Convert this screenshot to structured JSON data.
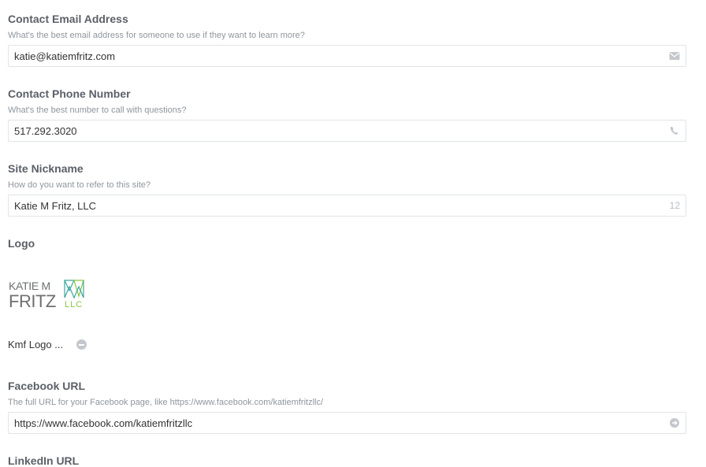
{
  "contact_email": {
    "label": "Contact Email Address",
    "help": "What's the best email address for someone to use if they want to learn more?",
    "value": "katie@katiemfritz.com",
    "icon": "envelope-icon"
  },
  "contact_phone": {
    "label": "Contact Phone Number",
    "help": "What's the best number to call with questions?",
    "value": "517.292.3020",
    "icon": "phone-icon"
  },
  "site_nickname": {
    "label": "Site Nickname",
    "help": "How do you want to refer to this site?",
    "value": "Katie M Fritz, LLC",
    "char_count": "12"
  },
  "logo": {
    "label": "Logo",
    "image_text_line1": "KATIE M",
    "image_text_line2": "FRITZ",
    "image_text_suffix": "LLC",
    "filename": "Kmf Logo ...",
    "remove_icon": "minus-circle-icon"
  },
  "facebook_url": {
    "label": "Facebook URL",
    "help": "The full URL for your Facebook page, like https://www.facebook.com/katiemfritzllc/",
    "value": "https://www.facebook.com/katiemfritzllc",
    "icon": "arrow-circle-right-icon"
  },
  "linkedin_url": {
    "label": "LinkedIn URL"
  },
  "colors": {
    "label": "#5b6068",
    "help": "#8f969e",
    "border": "#e1e4e8",
    "icon": "#c4c8cd",
    "logo_gray": "#6d6f71",
    "logo_teal": "#3aa6a0",
    "logo_green": "#8cc63f"
  }
}
